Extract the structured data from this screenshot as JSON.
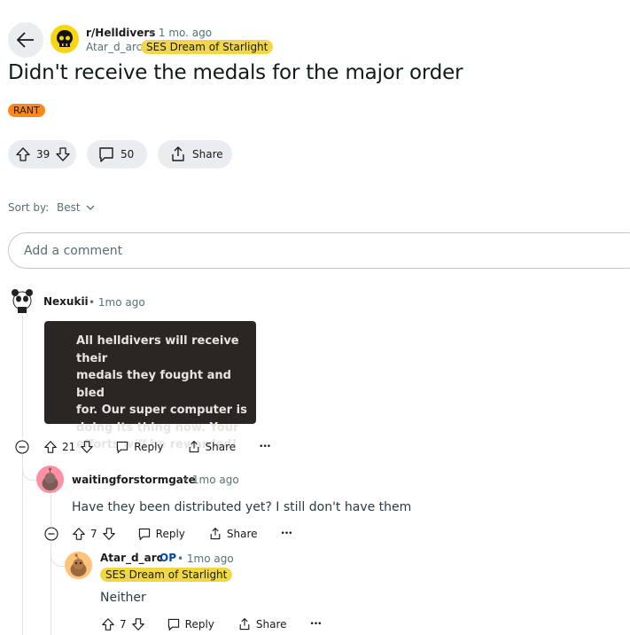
{
  "post": {
    "subreddit": "r/Helldivers",
    "time": "• 1 mo. ago",
    "author": "Atar_d_arc",
    "author_flair": "SES Dream of Starlight",
    "title": "Didn't receive the medals for the major order",
    "post_flair": "RANT",
    "votes": "39",
    "comments": "50",
    "share_label": "Share"
  },
  "sort": {
    "label": "Sort by:",
    "value": "Best"
  },
  "comment_input": {
    "placeholder": "Add a comment"
  },
  "comments": [
    {
      "user": "Nexukii",
      "time": "• 1mo ago",
      "image_text": {
        "line1": "All helldivers will receive their",
        "line2": "medals they fought and bled",
        "line3": "for. Our super computer is",
        "line4": "doing its thing now. Your",
        "line5a": "efforts ",
        "line5b": "will",
        "line5c": " be rewarded!"
      },
      "votes": "21",
      "reply_label": "Reply",
      "share_label": "Share",
      "more": "•••"
    },
    {
      "user": "waitingforstormgate",
      "time": "• 1mo ago",
      "body": "Have they been distributed yet? I still don't have them",
      "votes": "7",
      "reply_label": "Reply",
      "share_label": "Share",
      "more": "•••"
    },
    {
      "user": "Atar_d_arc",
      "op": "OP",
      "time": "• 1mo ago",
      "flair": "SES Dream of Starlight",
      "body": "Neither",
      "votes": "7",
      "reply_label": "Reply",
      "share_label": "Share",
      "more": "•••"
    }
  ],
  "colors": {
    "flair_yellow": "#f1d745",
    "rant_orange": "#ff8717",
    "pill_gray": "#eaedef",
    "op_blue": "#0045ac"
  },
  "icons": [
    "back-arrow-icon",
    "helldivers-skull-icon",
    "upvote-icon",
    "downvote-icon",
    "comment-icon",
    "share-icon",
    "chevron-down-icon",
    "collapse-icon",
    "more-icon"
  ]
}
